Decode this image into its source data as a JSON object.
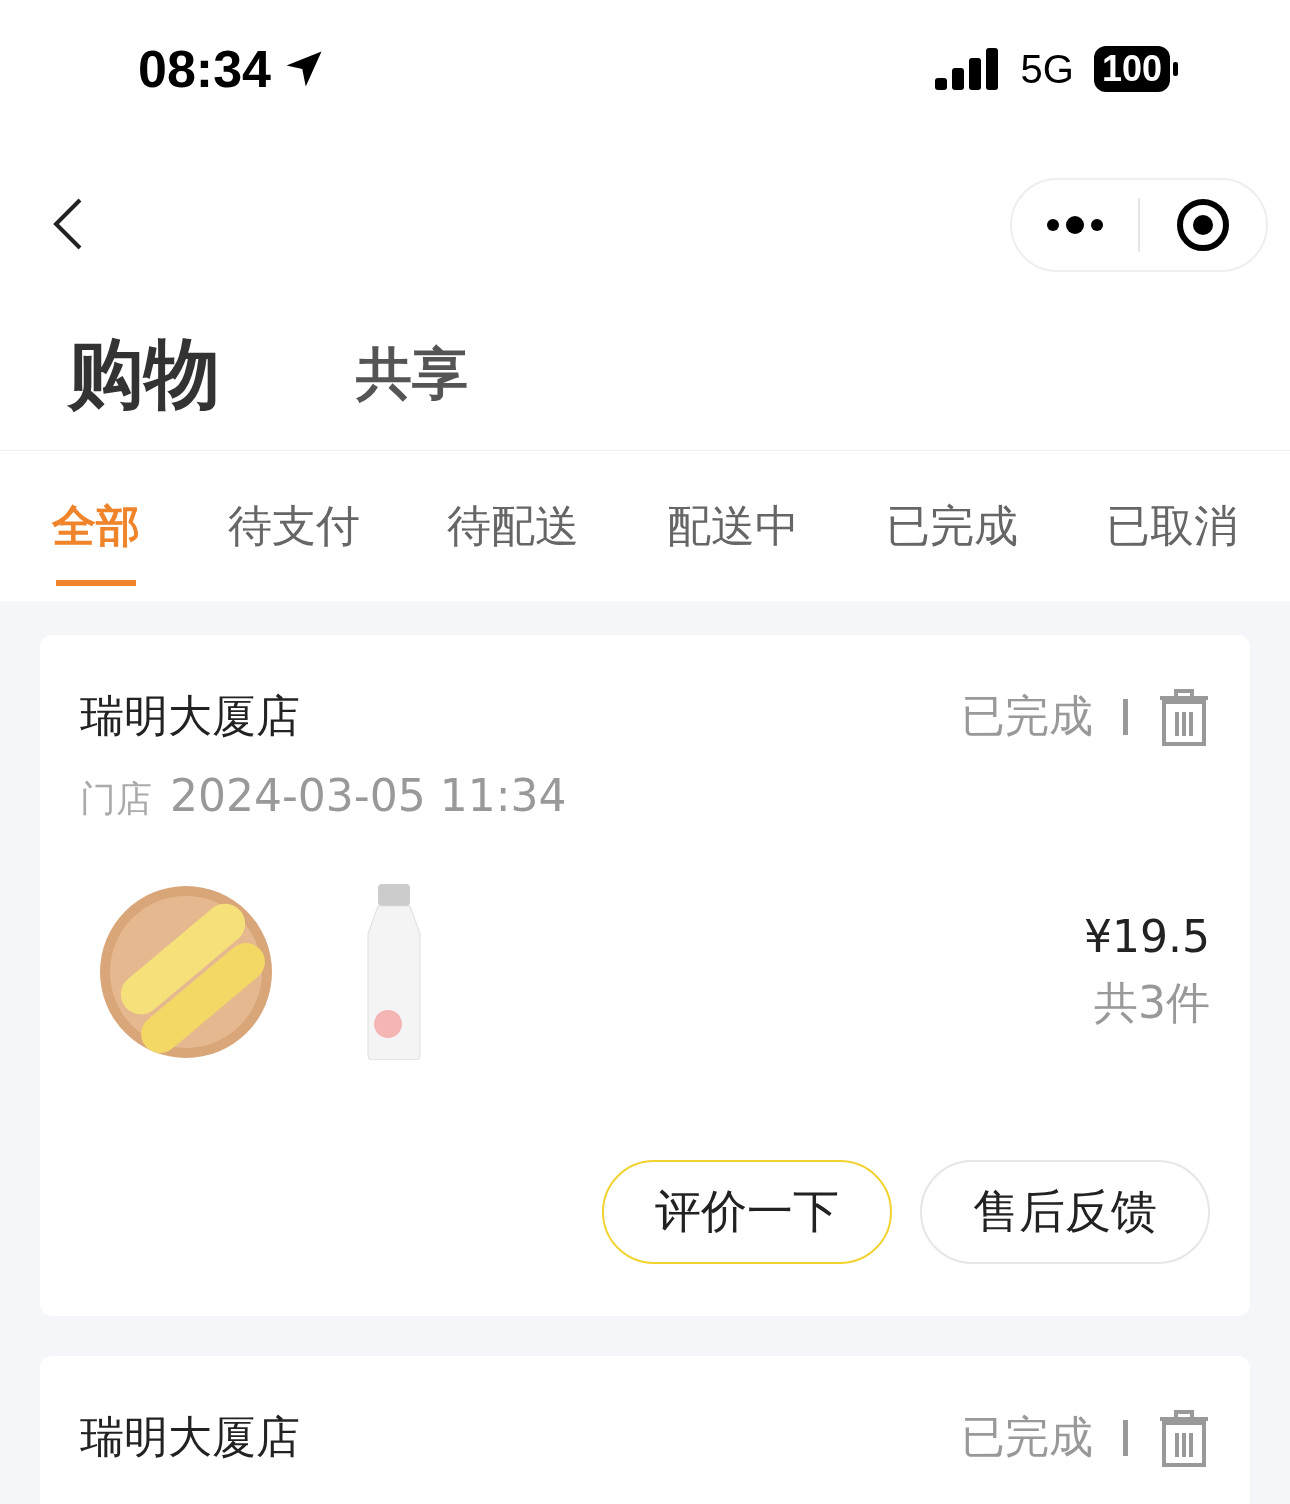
{
  "status_bar": {
    "time": "08:34",
    "network": "5G",
    "battery": "100"
  },
  "section_tabs": [
    {
      "label": "购物",
      "selected": true
    },
    {
      "label": "共享",
      "selected": false
    }
  ],
  "filter_tabs": [
    {
      "label": "全部",
      "selected": true
    },
    {
      "label": "待支付",
      "selected": false
    },
    {
      "label": "待配送",
      "selected": false
    },
    {
      "label": "配送中",
      "selected": false
    },
    {
      "label": "已完成",
      "selected": false
    },
    {
      "label": "已取消",
      "selected": false
    }
  ],
  "orders": [
    {
      "store": "瑞明大厦店",
      "status": "已完成",
      "channel": "门店",
      "datetime": "2024-03-05 11:34",
      "price": "¥19.5",
      "count": "共3件",
      "buttons": [
        {
          "label": "评价一下",
          "kind": "primary"
        },
        {
          "label": "售后反馈",
          "kind": "default"
        }
      ]
    },
    {
      "store": "瑞明大厦店",
      "status": "已完成"
    }
  ]
}
